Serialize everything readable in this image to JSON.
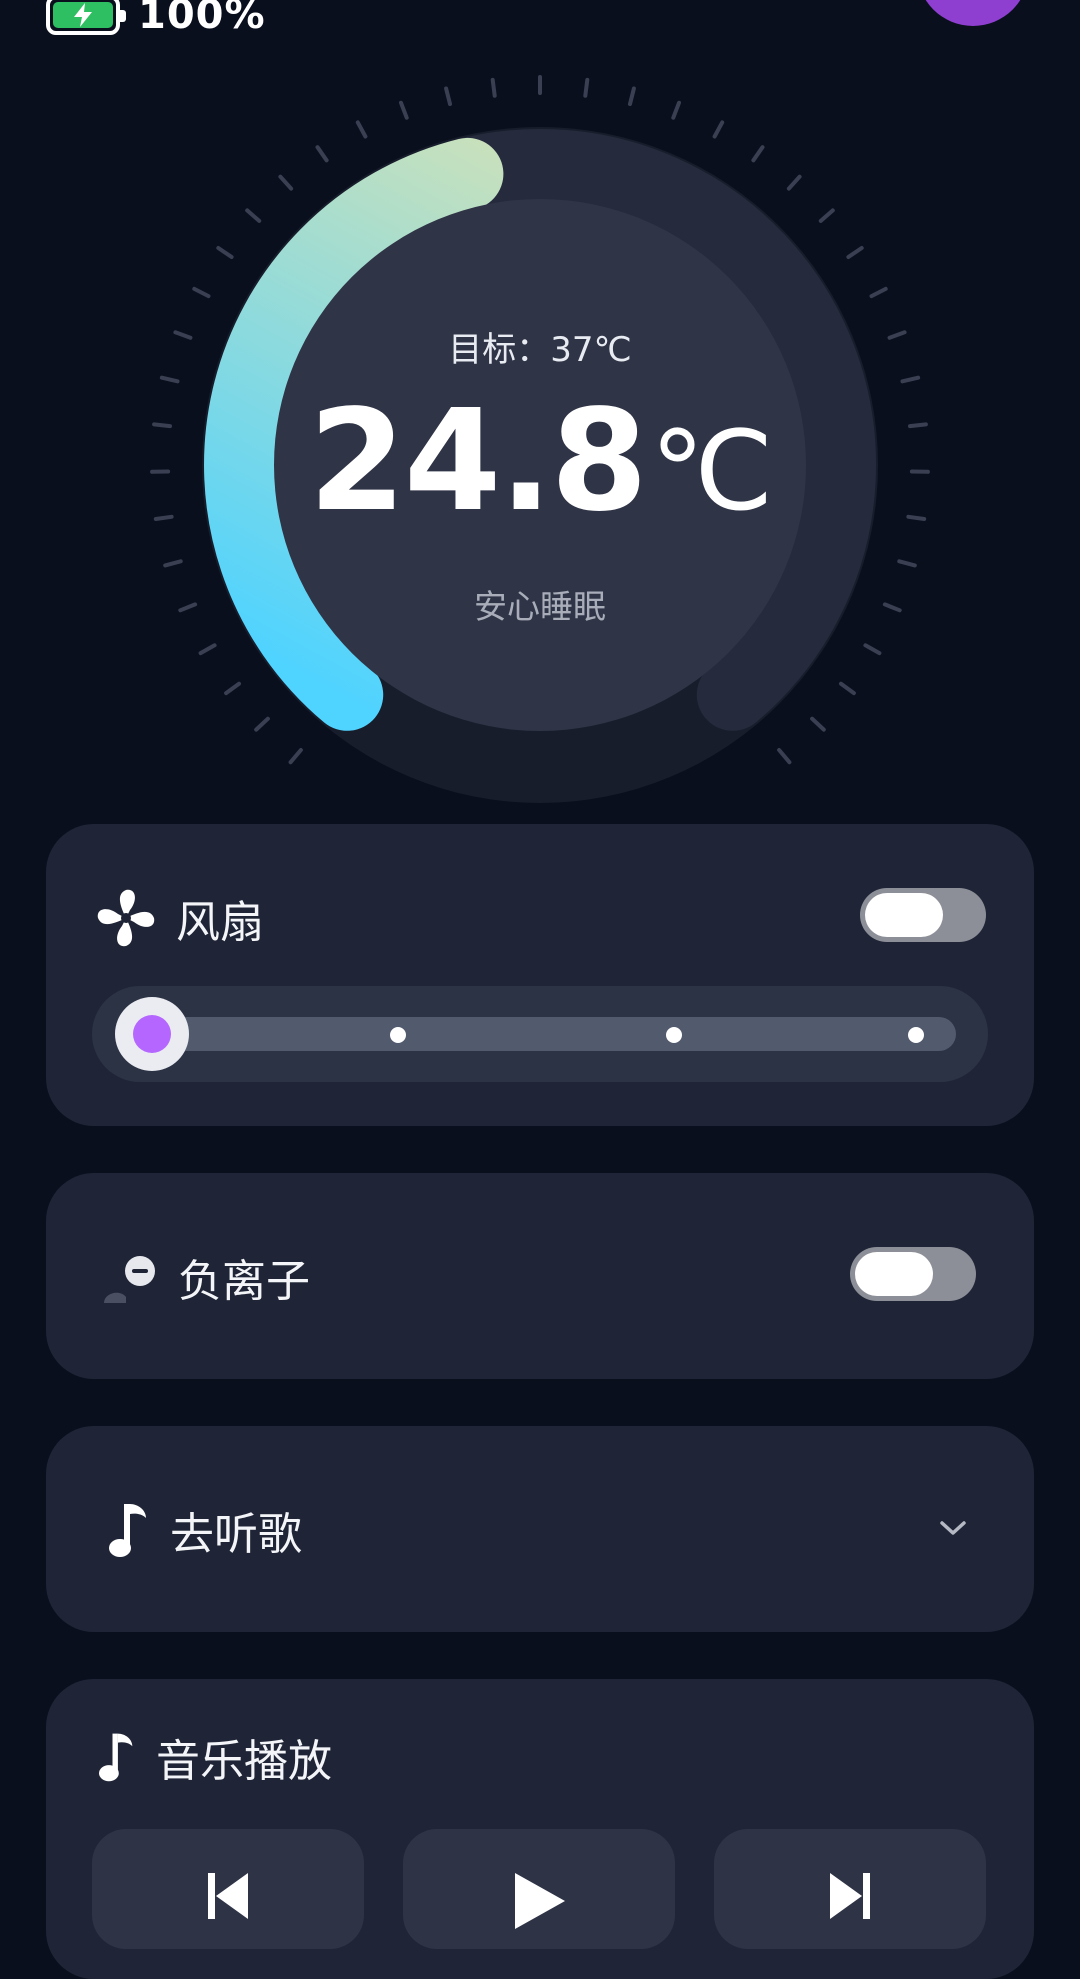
{
  "status_bar": {
    "battery_level": "100%"
  },
  "thermostat": {
    "target_label": "目标：37℃",
    "current_value": "24.8",
    "current_unit": "℃",
    "mode_label": "安心睡眠",
    "arc_fraction": 0.45,
    "arc_start_color": "#4fd3ff",
    "arc_end_color": "#d3e2b6"
  },
  "fan": {
    "title": "风扇",
    "toggle_on": false,
    "level": 0,
    "levels": 4,
    "accent": "#b466ff"
  },
  "anion": {
    "title": "负离子",
    "toggle_on": false
  },
  "music_entry": {
    "title": "去听歌"
  },
  "music_player": {
    "title": "音乐播放",
    "controls": [
      "previous-icon",
      "play-icon",
      "next-icon"
    ]
  }
}
